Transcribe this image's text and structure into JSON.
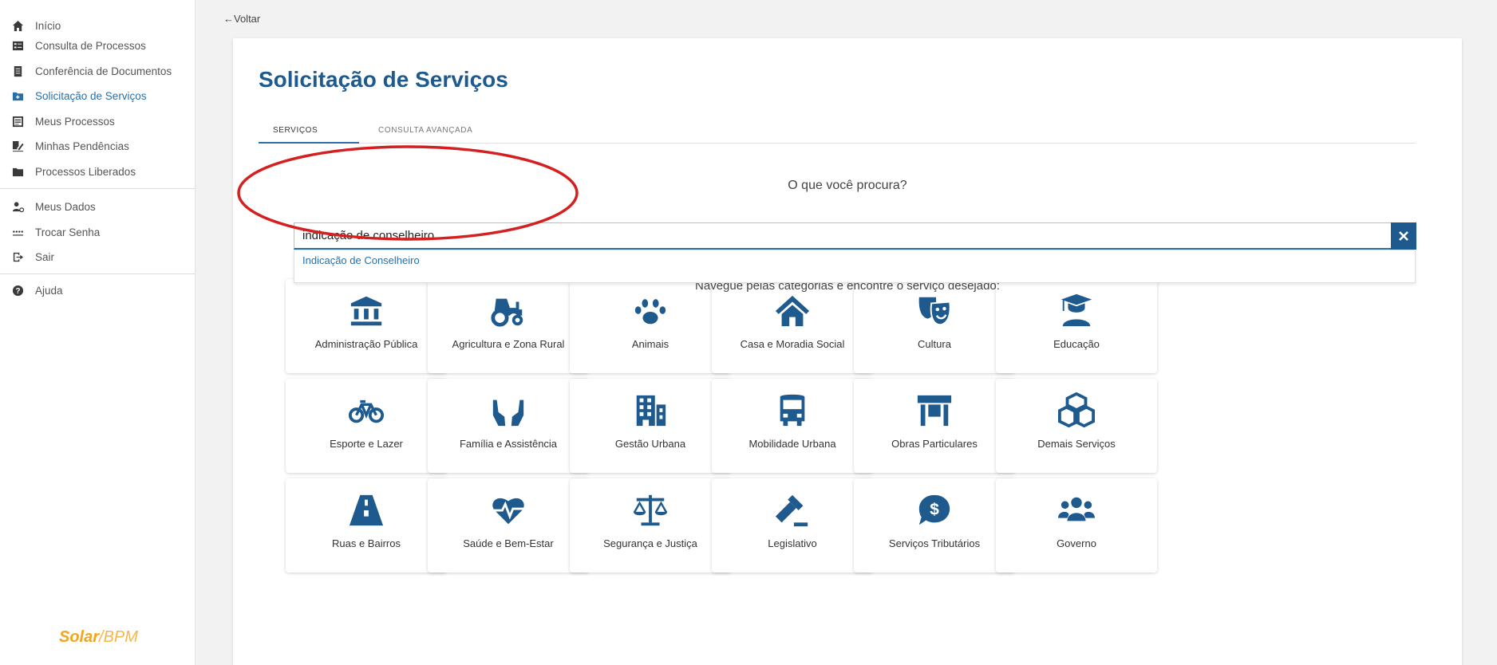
{
  "sidebar": {
    "items": [
      {
        "label": "Início",
        "icon": "home-icon"
      },
      {
        "label": "Consulta de Processos",
        "icon": "list-box-icon"
      },
      {
        "label": "Conferência de Documentos",
        "icon": "document-icon"
      },
      {
        "label": "Solicitação de Serviços",
        "icon": "folder-plus-icon"
      },
      {
        "label": "Meus Processos",
        "icon": "list-icon"
      },
      {
        "label": "Minhas Pendências",
        "icon": "signature-icon"
      },
      {
        "label": "Processos Liberados",
        "icon": "folder-icon"
      },
      {
        "label": "Meus Dados",
        "icon": "user-settings-icon"
      },
      {
        "label": "Trocar Senha",
        "icon": "password-icon"
      },
      {
        "label": "Sair",
        "icon": "logout-icon"
      },
      {
        "label": "Ajuda",
        "icon": "help-icon"
      }
    ],
    "active_index": 3,
    "logo_part1": "Solar",
    "logo_part2": "/BPM",
    "accent": "#2a6fa8"
  },
  "top": {
    "back_label": "←Voltar"
  },
  "page": {
    "title": "Solicitação de Serviços",
    "tabs": [
      {
        "label": "SERVIÇOS",
        "active": true
      },
      {
        "label": "CONSULTA AVANÇADA",
        "active": false
      }
    ],
    "question": "O que você procura?",
    "search_value": "indicação de conselheiro",
    "suggestion": "Indicação de Conselheiro",
    "browse_text": "Navegue pelas categorias e encontre o serviço desejado:",
    "primary_color": "#1e5a8e",
    "annotation_color": "#d42020"
  },
  "categories": [
    {
      "label": "Administração Pública",
      "icon": "landmark-icon"
    },
    {
      "label": "Agricultura e Zona Rural",
      "icon": "tractor-icon"
    },
    {
      "label": "Animais",
      "icon": "paw-icon"
    },
    {
      "label": "Casa e Moradia Social",
      "icon": "house-icon"
    },
    {
      "label": "Cultura",
      "icon": "theater-masks-icon"
    },
    {
      "label": "Educação",
      "icon": "teacher-icon"
    },
    {
      "label": "Esporte e Lazer",
      "icon": "bicycle-icon"
    },
    {
      "label": "Família e Assistência",
      "icon": "hands-icon"
    },
    {
      "label": "Gestão Urbana",
      "icon": "buildings-icon"
    },
    {
      "label": "Mobilidade Urbana",
      "icon": "bus-icon"
    },
    {
      "label": "Obras Particulares",
      "icon": "store-icon"
    },
    {
      "label": "Demais Serviços",
      "icon": "cubes-icon"
    },
    {
      "label": "Ruas e Bairros",
      "icon": "road-icon"
    },
    {
      "label": "Saúde e Bem-Estar",
      "icon": "heartbeat-icon"
    },
    {
      "label": "Segurança  e Justiça",
      "icon": "scales-icon"
    },
    {
      "label": "Legislativo",
      "icon": "gavel-icon"
    },
    {
      "label": "Serviços Tributários",
      "icon": "money-bubble-icon"
    },
    {
      "label": "Governo",
      "icon": "users-icon"
    }
  ]
}
